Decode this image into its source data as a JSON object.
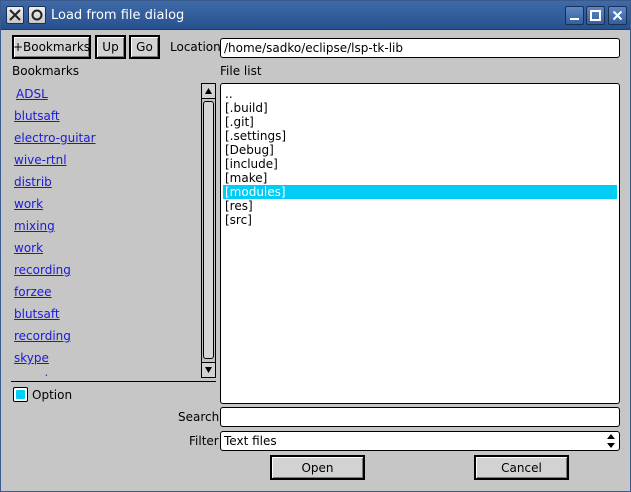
{
  "window": {
    "title": "Load from file dialog"
  },
  "toolbar": {
    "add_bookmark_label": "+Bookmarks",
    "up_label": "Up",
    "go_label": "Go",
    "location_label": "Location",
    "location_value": "/home/sadko/eclipse/lsp-tk-lib"
  },
  "bookmarks": {
    "heading": "Bookmarks",
    "items": [
      {
        "label": "ADSL"
      },
      {
        "label": "blutsaft"
      },
      {
        "label": "electro-guitar"
      },
      {
        "label": "wive-rtnl"
      },
      {
        "label": "distrib"
      },
      {
        "label": "work"
      },
      {
        "label": "mixing"
      },
      {
        "label": "work"
      },
      {
        "label": "recording"
      },
      {
        "label": "forzee"
      },
      {
        "label": "blutsaft"
      },
      {
        "label": "recording"
      },
      {
        "label": "skype"
      },
      {
        "label": "mood"
      }
    ]
  },
  "option": {
    "label": "Option",
    "checked": true
  },
  "files": {
    "heading": "File list",
    "items": [
      {
        "name": ".."
      },
      {
        "name": "[.build]"
      },
      {
        "name": "[.git]"
      },
      {
        "name": "[.settings]"
      },
      {
        "name": "[Debug]"
      },
      {
        "name": "[include]"
      },
      {
        "name": "[make]"
      },
      {
        "name": "[modules]",
        "selected": true
      },
      {
        "name": "[res]"
      },
      {
        "name": "[src]"
      }
    ]
  },
  "search": {
    "label": "Search",
    "value": ""
  },
  "filter": {
    "label": "Filter",
    "value": "Text files"
  },
  "actions": {
    "open_label": "Open",
    "cancel_label": "Cancel"
  },
  "colors": {
    "selection": "#00ccf5",
    "link": "#1a1ad8",
    "titlebar": "#3f6aa8"
  }
}
